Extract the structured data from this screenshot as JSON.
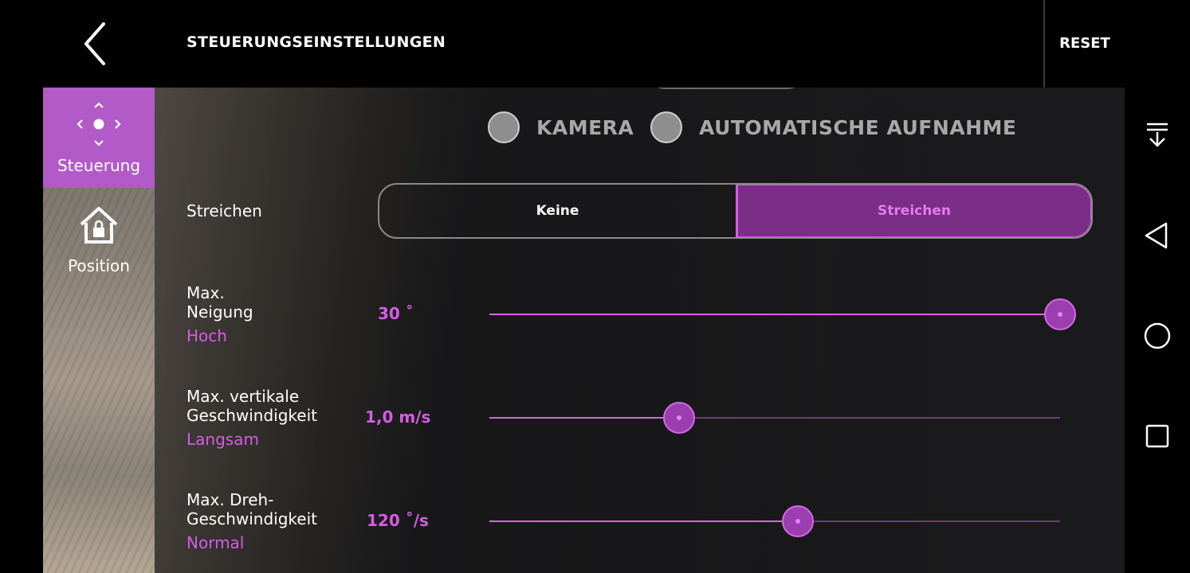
{
  "header": {
    "title": "STEUERUNGSEINSTELLUNGEN",
    "reset_label": "RESET"
  },
  "sidebar": {
    "items": [
      {
        "label": "Steuerung",
        "icon": "dpad-arrows-icon",
        "active": true
      },
      {
        "label": "Position",
        "icon": "home-lock-icon",
        "active": false
      }
    ]
  },
  "mode_options": [
    {
      "label": "KAMERA",
      "selected": false
    },
    {
      "label": "AUTOMATISCHE AUFNAHME",
      "selected": false
    }
  ],
  "swipe": {
    "label": "Streichen",
    "options": [
      "Keine",
      "Streichen"
    ],
    "selected": "Streichen"
  },
  "sliders": [
    {
      "label_line1": "Max.",
      "label_line2": "Neigung",
      "level": "Hoch",
      "value": "30 ˚",
      "fraction": 1.0
    },
    {
      "label_line1": "Max. vertikale",
      "label_line2": "Geschwindigkeit",
      "level": "Langsam",
      "value": "1,0 m/s",
      "fraction": 0.333
    },
    {
      "label_line1": "Max. Dreh-",
      "label_line2": "Geschwindigkeit",
      "level": "Normal",
      "value": "120 ˚/s",
      "fraction": 0.54
    }
  ],
  "colors": {
    "accent": "#d65ce6",
    "active_sidebar": "#b25ac8",
    "segment_selected": "#7a2e86"
  },
  "system_nav": [
    "notification-shade-icon",
    "back-triangle-icon",
    "home-circle-icon",
    "recents-square-icon"
  ]
}
